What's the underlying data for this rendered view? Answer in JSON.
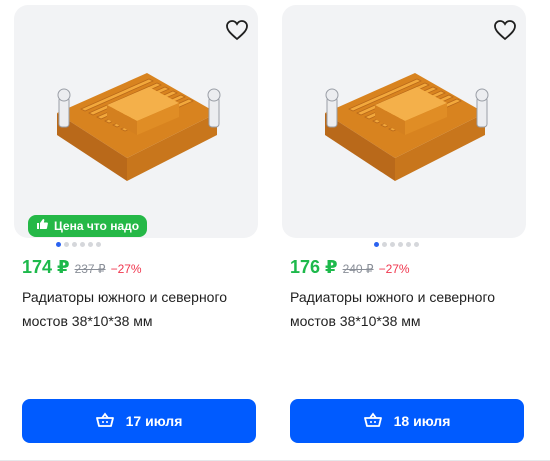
{
  "products": [
    {
      "badge": "Цена что надо",
      "price": "174 ₽",
      "old_price": "237 ₽",
      "discount": "−27%",
      "title": "Радиаторы южного и северного мостов 38*10*38 мм",
      "delivery": "17 июля",
      "gallery_dots": 6,
      "gallery_active": 0
    },
    {
      "price": "176 ₽",
      "old_price": "240 ₽",
      "discount": "−27%",
      "title": "Радиаторы южного и северного мостов 38*10*38 мм",
      "delivery": "18 июля",
      "gallery_dots": 6,
      "gallery_active": 0
    }
  ],
  "colors": {
    "price": "#1db94b",
    "discount": "#f0364e",
    "badge": "#25b847",
    "button": "#005bff",
    "heatsink": "#e89a2e"
  },
  "icons": {
    "favorite": "heart-outline-icon",
    "badge": "thumbs-up-icon",
    "button": "basket-icon",
    "image": "heatsink-product-image"
  }
}
